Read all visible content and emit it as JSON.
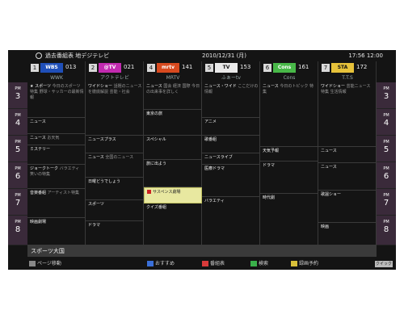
{
  "topbar": {
    "title": "過去番組表 地デジテレビ",
    "date": "2010/12/31 (月)",
    "time": "17:56 12:00"
  },
  "channels": [
    {
      "num": "1",
      "logo": "WBS",
      "cnum": "013",
      "name": "WWK",
      "logo_bg": "#1f4fb8",
      "logo_fg": "#ffffff"
    },
    {
      "num": "2",
      "logo": "@TV",
      "cnum": "021",
      "name": "アクトテレビ",
      "logo_bg": "#c22ab0",
      "logo_fg": "#ffffff"
    },
    {
      "num": "4",
      "logo": "mrtv",
      "cnum": "141",
      "name": "MRTV",
      "logo_bg": "#d84a1f",
      "logo_fg": "#ffffff"
    },
    {
      "num": "5",
      "logo": "TV",
      "cnum": "153",
      "name": "ふぁーtv",
      "logo_bg": "#e9e9e9",
      "logo_fg": "#111111"
    },
    {
      "num": "6",
      "logo": "Cons",
      "cnum": "161",
      "name": "Cons",
      "logo_bg": "#48b848",
      "logo_fg": "#ffffff"
    },
    {
      "num": "7",
      "logo": "STA",
      "cnum": "172",
      "name": "T.T.S",
      "logo_bg": "#e6c23a",
      "logo_fg": "#111111"
    }
  ],
  "hours": [
    {
      "pm": "PM",
      "h": "3"
    },
    {
      "pm": "PM",
      "h": "4"
    },
    {
      "pm": "PM",
      "h": "5"
    },
    {
      "pm": "PM",
      "h": "6"
    },
    {
      "pm": "PM",
      "h": "7"
    },
    {
      "pm": "PM",
      "h": "8"
    }
  ],
  "columns": [
    [
      {
        "t": "★ スポーツ",
        "d": "今日のスポーツ特集 野球・サッカーの最新情報",
        "h": 44
      },
      {
        "t": "ニュース",
        "d": "",
        "h": 20
      },
      {
        "t": "ニュース",
        "d": "お天気",
        "h": 14
      },
      {
        "t": "ミステリー",
        "d": "",
        "h": 24
      },
      {
        "t": "ジョークトーク",
        "d": "バラエティ 笑いの特集",
        "h": 30
      },
      {
        "t": "音楽番組",
        "d": "アーティスト特集",
        "h": 36
      },
      {
        "t": "映画劇場",
        "d": "",
        "h": 34
      }
    ],
    [
      {
        "t": "ワイドショー",
        "d": "話題のニュースを徹底解説 芸能・社会",
        "h": 66
      },
      {
        "t": "ニュースプラス",
        "d": "",
        "h": 22
      },
      {
        "t": "ニュース",
        "d": "全国のニュース",
        "h": 30
      },
      {
        "t": "日曜どうでしょう",
        "d": "",
        "h": 28
      },
      {
        "t": "スポーツ",
        "d": "",
        "h": 26
      },
      {
        "t": "ドラマ",
        "d": "",
        "h": 30
      }
    ],
    [
      {
        "t": "ニュース",
        "d": "国会 経済 国際 今日の出来事を詳しく",
        "h": 34
      },
      {
        "t": "東京の旅",
        "d": "",
        "h": 32
      },
      {
        "t": "スペシャル",
        "d": "",
        "h": 30
      },
      {
        "t": "旅に出よう",
        "d": "",
        "h": 34
      },
      {
        "t": "サスペンス劇場",
        "d": "",
        "h": 20,
        "sel": true
      },
      {
        "t": "クイズ番組",
        "d": "",
        "h": 52
      }
    ],
    [
      {
        "t": "ニュース・ワイド",
        "d": "ここだけの情報",
        "h": 44
      },
      {
        "t": "アニメ",
        "d": "",
        "h": 22
      },
      {
        "t": "歌番組",
        "d": "",
        "h": 22
      },
      {
        "t": "ニュースライブ",
        "d": "",
        "h": 14
      },
      {
        "t": "医療ドラマ",
        "d": "",
        "h": 40
      },
      {
        "t": "バラエティ",
        "d": "",
        "h": 60
      }
    ],
    [
      {
        "t": "ニュース",
        "d": "今日のトピック 特集",
        "h": 80
      },
      {
        "t": "天気予報",
        "d": "",
        "h": 18
      },
      {
        "t": "ドラマ",
        "d": "",
        "h": 40
      },
      {
        "t": "時代劇",
        "d": "",
        "h": 64
      }
    ],
    [
      {
        "t": "ワイドショー",
        "d": "芸能ニュース 特集 生活情報",
        "h": 80
      },
      {
        "t": "ニュース",
        "d": "",
        "h": 20
      },
      {
        "t": "ニュース",
        "d": "",
        "h": 34
      },
      {
        "t": "歌謡ショー",
        "d": "",
        "h": 40
      },
      {
        "t": "映画",
        "d": "",
        "h": 28
      }
    ]
  ],
  "selected_info": "スポーツ大国",
  "bottombar": {
    "page": "ページ移動",
    "blue": "おすすめ",
    "red": "番組表",
    "green": "検索",
    "yellow": "録画予約",
    "quick": "クイック"
  },
  "colors": {
    "hour_bg": "#3a2a3a",
    "selected": "#e8e8a0"
  }
}
